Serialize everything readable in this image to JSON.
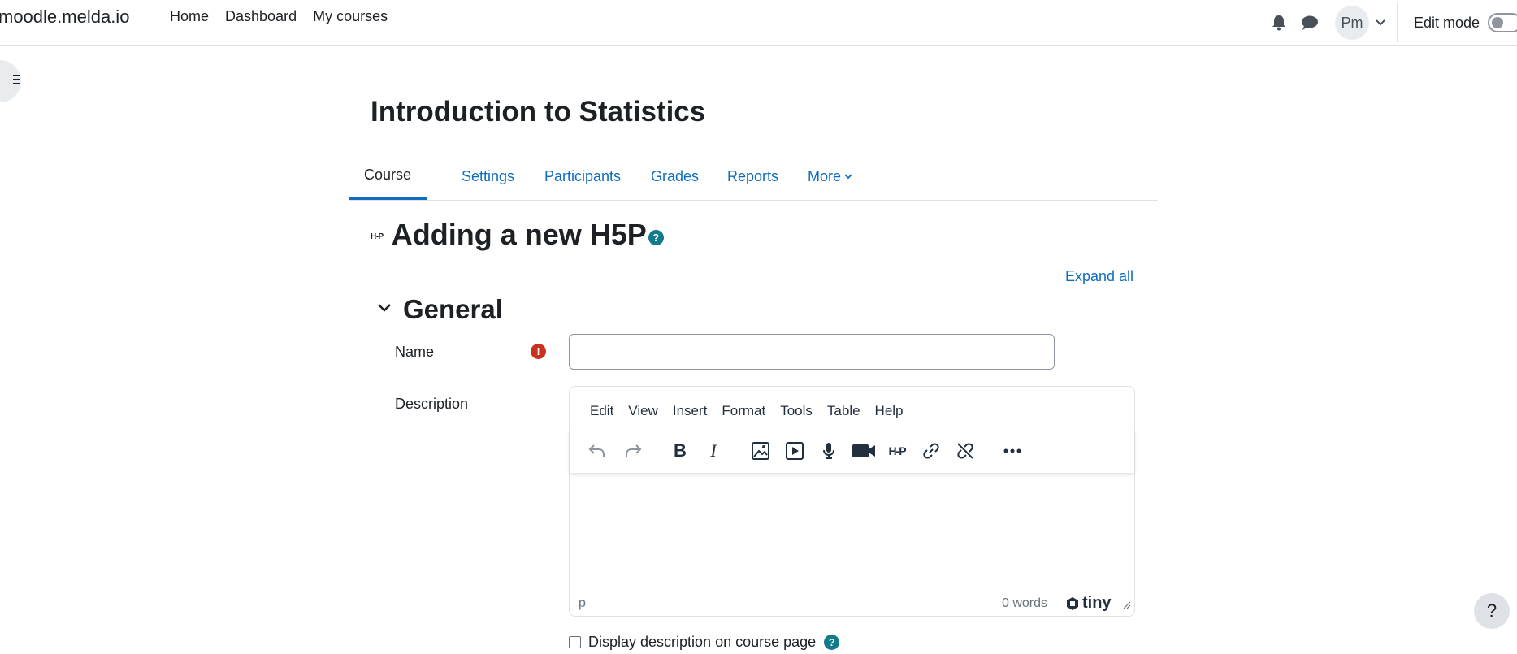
{
  "navbar": {
    "brand": "moodle.melda.io",
    "links": [
      "Home",
      "Dashboard",
      "My courses"
    ],
    "avatar_initials": "Pm",
    "edit_mode_label": "Edit mode"
  },
  "page": {
    "title": "Introduction to Statistics"
  },
  "secondary_nav": {
    "tabs": [
      "Course",
      "Settings",
      "Participants",
      "Grades",
      "Reports",
      "More"
    ],
    "active": "Course"
  },
  "activity": {
    "badge": "H-P",
    "title": "Adding a new H5P",
    "expand_all": "Expand all"
  },
  "general": {
    "title": "General",
    "name_label": "Name",
    "name_value": "",
    "description_label": "Description"
  },
  "editor": {
    "menus": [
      "Edit",
      "View",
      "Insert",
      "Format",
      "Tools",
      "Table",
      "Help"
    ],
    "status_path": "p",
    "word_count": "0 words",
    "brand": "tiny"
  },
  "checkbox": {
    "label": "Display description on course page",
    "checked": false
  },
  "float_help": "?",
  "colors": {
    "link": "#0f6cbf",
    "help": "#117a8b",
    "required": "#ca3120"
  },
  "icons": [
    "bell-icon",
    "chat-icon",
    "chevron-down-icon",
    "drawer-icon",
    "undo-icon",
    "redo-icon",
    "bold-icon",
    "italic-icon",
    "image-icon",
    "media-icon",
    "microphone-icon",
    "video-camera-icon",
    "h5p-icon",
    "link-icon",
    "unlink-icon",
    "more-icon"
  ]
}
